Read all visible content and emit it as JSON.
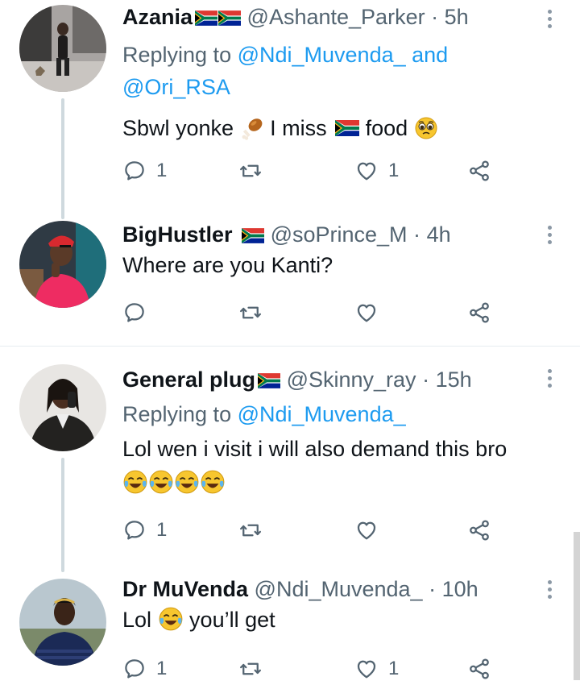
{
  "tweets": [
    {
      "name": "Azania",
      "handle": "@Ashante_Parker",
      "sep": "·",
      "time": "5h",
      "replying_prefix": "Replying to ",
      "replying_mentions": [
        "@Ndi_Muvenda_",
        "@Ori_RSA"
      ],
      "replying_joiner": " and",
      "text_parts": [
        "Sbwl yonke ",
        " I miss ",
        " food "
      ],
      "reply_count": "1",
      "retweet_count": "",
      "like_count": "1"
    },
    {
      "name": "BigHustler",
      "handle": "@soPrince_M",
      "sep": "·",
      "time": "4h",
      "text": "Where are you Kanti?",
      "reply_count": "",
      "retweet_count": "",
      "like_count": ""
    },
    {
      "name": "General plug",
      "handle": "@Skinny_ray",
      "sep": "·",
      "time": "15h",
      "replying_prefix": "Replying to ",
      "replying_mentions": [
        "@Ndi_Muvenda_"
      ],
      "text": "Lol wen i visit i will also demand this bro",
      "reply_count": "1",
      "retweet_count": "",
      "like_count": ""
    },
    {
      "name": "Dr MuVenda",
      "handle": "@Ndi_Muvenda_",
      "sep": "·",
      "time": "10h",
      "text_parts": [
        "Lol ",
        " you’ll get"
      ],
      "reply_count": "1",
      "retweet_count": "",
      "like_count": "1"
    }
  ],
  "icons": {
    "reply": "reply-icon",
    "retweet": "retweet-icon",
    "like": "heart-icon",
    "share": "share-icon",
    "more": "more-icon",
    "flag": "south-africa-flag-icon"
  },
  "colors": {
    "accent": "#1d9bf0",
    "secondary_text": "#536471",
    "thread_line": "#cfd9de"
  }
}
